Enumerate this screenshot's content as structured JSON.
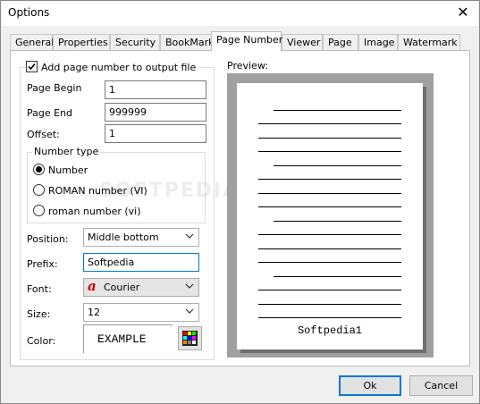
{
  "window": {
    "title": "Options",
    "close_glyph": "✕"
  },
  "tabs": [
    {
      "label": "General"
    },
    {
      "label": "Properties"
    },
    {
      "label": "Security"
    },
    {
      "label": "BookMark"
    },
    {
      "label": "Page Number",
      "active": true
    },
    {
      "label": "Viewer"
    },
    {
      "label": "Page"
    },
    {
      "label": "Image"
    },
    {
      "label": "Watermark"
    }
  ],
  "page_number": {
    "add_checkbox_label": "Add page number to output file",
    "add_checked": true,
    "page_begin_label": "Page Begin",
    "page_begin_value": "1",
    "page_end_label": "Page End",
    "page_end_value": "999999",
    "offset_label": "Offset:",
    "offset_value": "1",
    "number_type": {
      "label": "Number type",
      "options": [
        "Number",
        "ROMAN number (VI)",
        "roman number (vi)"
      ],
      "selected": "Number"
    },
    "position_label": "Position:",
    "position_value": "Middle bottom",
    "prefix_label": "Prefix:",
    "prefix_value": "Softpedia",
    "font_label": "Font:",
    "font_value": "Courier",
    "font_icon": "a",
    "size_label": "Size:",
    "size_value": "12",
    "color_label": "Color:",
    "color_sample": "EXAMPLE"
  },
  "preview": {
    "label": "Preview:",
    "footer_text": "Softpedia1",
    "watermark": "SOFTPEDIA"
  },
  "buttons": {
    "ok": "Ok",
    "cancel": "Cancel"
  },
  "colors": {
    "accent": "#0078d7",
    "font_icon": "#cc0000"
  }
}
